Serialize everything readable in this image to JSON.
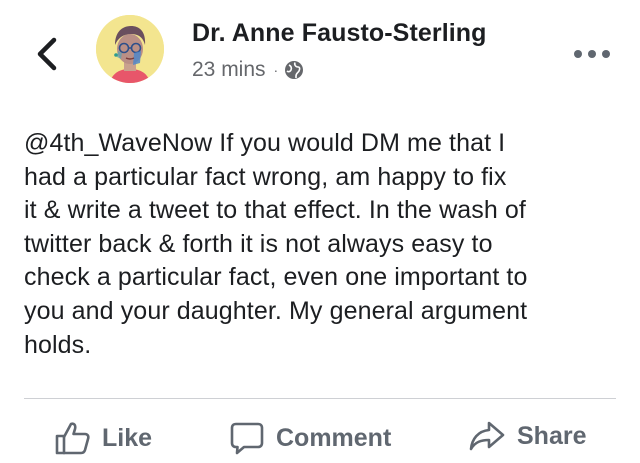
{
  "header": {
    "author_name": "Dr. Anne Fausto-Sterling",
    "timestamp": "23 mins",
    "separator": "·",
    "audience_icon": "globe-icon",
    "back_icon": "chevron-left-icon",
    "more_icon": "more-horizontal-icon"
  },
  "post": {
    "text": "@4th_WaveNow If you would DM me that I\nhad a particular fact wrong,  am happy to fix\nit & write a tweet to that effect. In the wash of\ntwitter back & forth it is not always easy to\ncheck a particular fact, even one important to\nyou and your daughter. My general argument\nholds."
  },
  "actions": {
    "like_label": "Like",
    "comment_label": "Comment",
    "share_label": "Share"
  },
  "colors": {
    "text_primary": "#1c1e21",
    "text_secondary": "#65676b",
    "action_gray": "#606770",
    "divider": "#ced0d4",
    "avatar_bg": "#f3e58f"
  }
}
